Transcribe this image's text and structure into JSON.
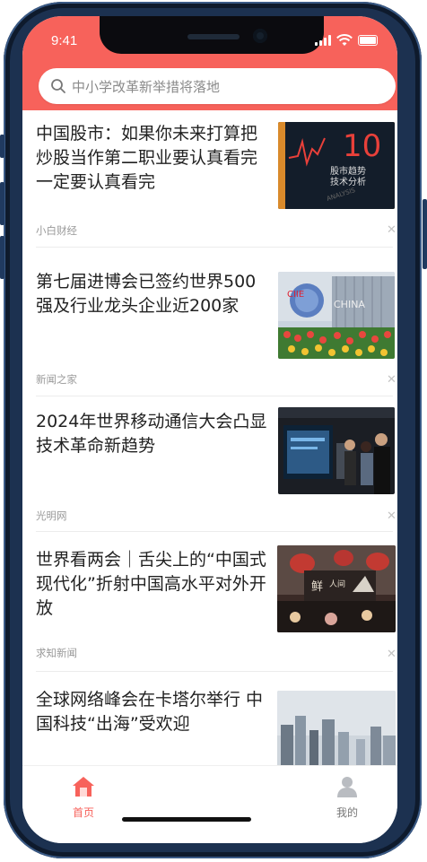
{
  "status_bar": {
    "time": "9:41"
  },
  "search": {
    "placeholder": "中小学改革新举措将落地"
  },
  "news": [
    {
      "title": "中国股市：如果你未来打算把炒股当作第二职业要认真看完一定要认真看完",
      "source": "小白财经",
      "close": "✕",
      "image": "stock-book-cover"
    },
    {
      "title": "第七届进博会已签约世界500强及行业龙头企业近200家",
      "source": "新闻之家",
      "close": "✕",
      "image": "expo-venue-flowers"
    },
    {
      "title": "2024年世界移动通信大会凸显技术革命新趋势",
      "source": "光明网",
      "close": "✕",
      "image": "tech-exhibition-visitors"
    },
    {
      "title": "世界看两会｜舌尖上的“中国式现代化”折射中国高水平对外开放",
      "source": "求知新闻",
      "close": "✕",
      "image": "food-stall-lanterns"
    },
    {
      "title": "全球网络峰会在卡塔尔举行 中国科技“出海”受欢迎",
      "source": "",
      "close": "",
      "image": "doha-skyline"
    }
  ],
  "tabbar": {
    "home": {
      "label": "首页",
      "icon": "home-icon",
      "active": true
    },
    "mine": {
      "label": "我的",
      "icon": "user-icon",
      "active": false
    }
  },
  "colors": {
    "accent": "#f7625b",
    "frame": "#1c3150"
  }
}
